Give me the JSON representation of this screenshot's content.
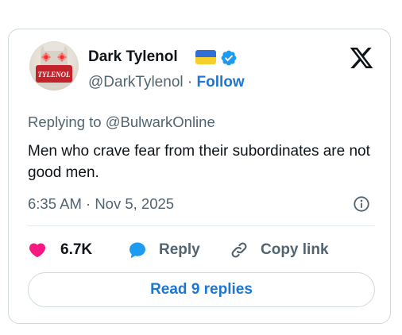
{
  "author": {
    "display_name": "Dark Tylenol",
    "handle": "@DarkTylenol",
    "separator": " · ",
    "follow_label": "Follow",
    "flag_icon": "ukraine-flag-icon",
    "verified_icon": "verified-badge-icon",
    "avatar_text": "TYLENOL"
  },
  "platform": {
    "logo_icon": "x-logo-icon"
  },
  "tweet": {
    "replying_to": "Replying to @BulwarkOnline",
    "text": "Men who crave fear from their subordinates are not good men.",
    "timestamp": "6:35 AM · Nov 5, 2025"
  },
  "actions": {
    "like_count": "6.7K",
    "reply_label": "Reply",
    "copy_link_label": "Copy link"
  },
  "read_replies_label": "Read 9 replies",
  "colors": {
    "link_blue": "#1d76d2",
    "heart_pink": "#f91880",
    "reply_blue": "#1d9bf0",
    "secondary_text": "#536471",
    "flag_blue": "#2f6fd6",
    "flag_yellow": "#f7cf2c"
  }
}
